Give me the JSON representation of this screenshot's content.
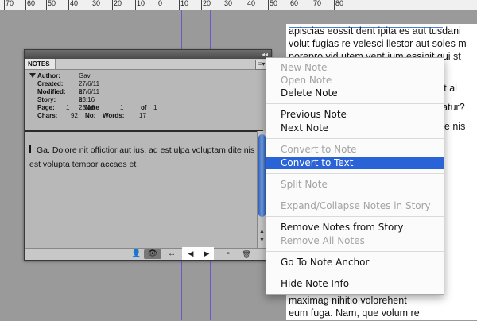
{
  "ruler": {
    "labels": [
      "70",
      "60",
      "50",
      "40",
      "30",
      "20",
      "10",
      "0",
      "10",
      "20",
      "30",
      "40",
      "50",
      "60",
      "70",
      "80"
    ]
  },
  "document": {
    "paragraphs": [
      "apiscias eossit dent ipita es aut tusdani volut fugias re velesci llestor aut soles m porepro vid utem vent ium essinit qui st asintur quam",
      "Icab is quossim tendit quae di editat al",
      "Lum qu autatur, dolores sinctis i quatur?",
      "Anihilla recto persper odissit i nati ve nis quam"
    ],
    "bottom_lines": [
      "maximag nihitio volorehent",
      "eum fuga. Nam, que volum re"
    ]
  },
  "notes_panel": {
    "tab_label": "NOTES",
    "author_label": "Author:",
    "author_value": "Gav",
    "created_label": "Created:",
    "created_value": "27/6/11 at 23:16",
    "modified_label": "Modified:",
    "modified_value": "27/6/11 at 23:16",
    "story_label": "Story:",
    "page_label": "Page:",
    "page_value": "1",
    "note_no_label": "Note No:",
    "note_no_value": "1",
    "of_label": "of",
    "of_value": "1",
    "chars_label": "Chars:",
    "chars_value": "92",
    "words_label": "Words:",
    "words_value": "17",
    "note_text": "Ga. Dolore nit offictior aut ius, ad est ulpa voluptam dite nis est volupta tempor accaes et",
    "collapse_glyph": "◂◂",
    "menu_glyph": "≡▾",
    "scroll_up_glyph": "▲",
    "scroll_down_glyph": "▼",
    "bottom_icons": {
      "person": "👤",
      "eye": "👁",
      "arrows": "↔",
      "prev": "◀",
      "next": "▶",
      "new": "▫",
      "trash": "🗑"
    }
  },
  "context_menu": {
    "items": [
      {
        "label": "New Note",
        "enabled": false
      },
      {
        "label": "Open Note",
        "enabled": false
      },
      {
        "label": "Delete Note",
        "enabled": true
      },
      {
        "label": "Previous Note",
        "enabled": true
      },
      {
        "label": "Next Note",
        "enabled": true
      },
      {
        "label": "Convert to Note",
        "enabled": false
      },
      {
        "label": "Convert to Text",
        "enabled": true,
        "highlighted": true
      },
      {
        "label": "Split Note",
        "enabled": false
      },
      {
        "label": "Expand/Collapse Notes in Story",
        "enabled": false
      },
      {
        "label": "Remove Notes from Story",
        "enabled": true
      },
      {
        "label": "Remove All Notes",
        "enabled": false
      },
      {
        "label": "Go To Note Anchor",
        "enabled": true
      },
      {
        "label": "Hide Note Info",
        "enabled": true
      }
    ]
  },
  "colors": {
    "highlight": "#2a63d8",
    "guide": "#6a5acd",
    "frame": "#4a7dd6"
  }
}
